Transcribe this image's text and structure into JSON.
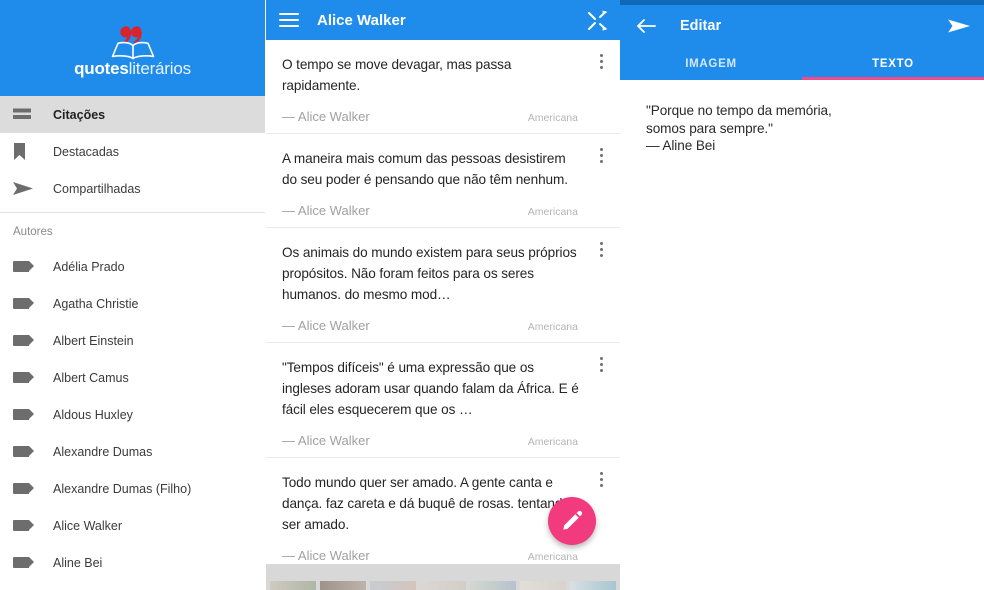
{
  "drawer": {
    "logo": {
      "icon": "open-book-with-quotation-marks",
      "text_primary": "quotes",
      "text_secondary": "literários",
      "quote_color": "#d8242c",
      "background": "#1f8cec"
    },
    "nav_items": [
      {
        "label": "Citações",
        "icon": "list-icon",
        "selected": true
      },
      {
        "label": "Destacadas",
        "icon": "bookmark-icon",
        "selected": false
      },
      {
        "label": "Compartilhadas",
        "icon": "send-icon",
        "selected": false
      }
    ],
    "section_title": "Autores",
    "authors": [
      {
        "label": "Adélia Prado",
        "icon": "tag-icon"
      },
      {
        "label": "Agatha Christie",
        "icon": "tag-icon"
      },
      {
        "label": "Albert  Einstein",
        "icon": "tag-icon"
      },
      {
        "label": "Albert Camus",
        "icon": "tag-icon"
      },
      {
        "label": "Aldous Huxley",
        "icon": "tag-icon"
      },
      {
        "label": "Alexandre Dumas",
        "icon": "tag-icon"
      },
      {
        "label": "Alexandre Dumas (Filho)",
        "icon": "tag-icon"
      },
      {
        "label": "Alice Walker",
        "icon": "tag-icon"
      },
      {
        "label": "Aline Bei",
        "icon": "tag-icon"
      }
    ]
  },
  "middle": {
    "appbar": {
      "menu_icon": "hamburger-menu-icon",
      "title": "Alice Walker",
      "action_icon": "shuffle-icon",
      "background": "#1f8cec"
    },
    "quotes": [
      {
        "text": "O tempo se move devagar, mas passa rapidamente.",
        "author": "— Alice Walker",
        "nationality": "Americana"
      },
      {
        "text": "A maneira mais comum das pessoas desistirem do seu poder é pensando que não têm nenhum.",
        "author": "— Alice Walker",
        "nationality": "Americana"
      },
      {
        "text": "Os animais do mundo existem para seus próprios propósitos. Não foram feitos para os seres humanos. do mesmo mod…",
        "author": "— Alice Walker",
        "nationality": "Americana"
      },
      {
        "text": "\"Tempos difíceis\" é uma expressão que os ingleses adoram usar quando falam da África. E é fácil eles esquecerem que os …",
        "author": "— Alice Walker",
        "nationality": "Americana"
      },
      {
        "text": "Todo mundo quer ser amado. A gente canta e dança. faz careta e dá buquê de rosas. tentando ser amado.",
        "author": "— Alice Walker",
        "nationality": "Americana"
      }
    ],
    "fab": {
      "icon": "pencil-edit-icon",
      "color": "#f23a7e"
    },
    "overflow_icon": "more-vertical-icon"
  },
  "right": {
    "appbar": {
      "back_icon": "arrow-left-icon",
      "title": "Editar",
      "send_icon": "send-icon",
      "background": "#1f8cec"
    },
    "tabs": [
      {
        "label": "IMAGEM",
        "active": false
      },
      {
        "label": "TEXTO",
        "active": true
      }
    ],
    "tab_indicator_color": "#ef4b8b",
    "editor_text": "\"Porque no tempo da memória,\nsomos para sempre.\"\n— Aline Bei"
  }
}
